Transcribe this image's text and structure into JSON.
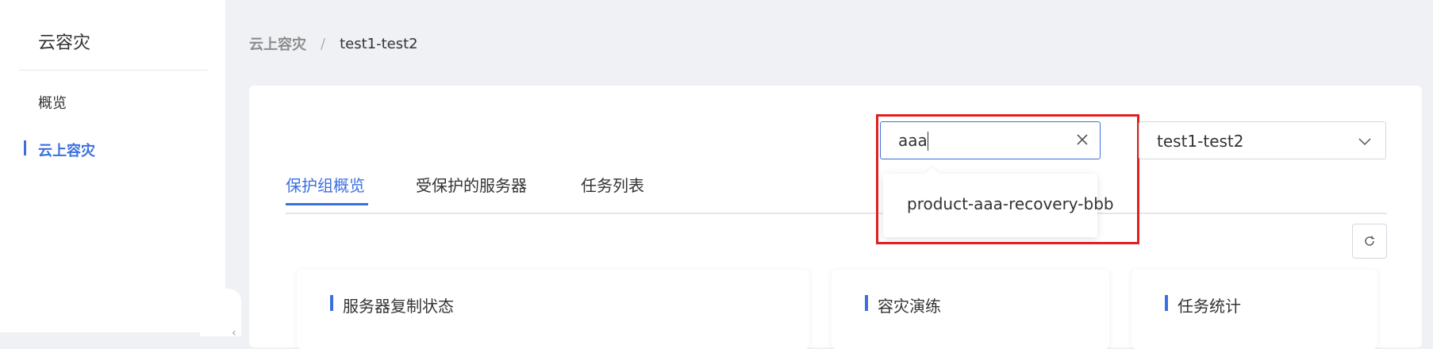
{
  "sidebar": {
    "title": "云容灾",
    "items": [
      {
        "label": "概览"
      },
      {
        "label": "云上容灾"
      }
    ]
  },
  "breadcrumb": {
    "root": "云上容灾",
    "separator": "/",
    "current": "test1-test2"
  },
  "tabs": [
    {
      "label": "保护组概览"
    },
    {
      "label": "受保护的服务器"
    },
    {
      "label": "任务列表"
    }
  ],
  "search": {
    "value": "aaa",
    "suggestions": [
      "product-aaa-recovery-bbb"
    ]
  },
  "select": {
    "value": "test1-test2"
  },
  "panels": [
    {
      "title": "服务器复制状态"
    },
    {
      "title": "容灾演练"
    },
    {
      "title": "任务统计"
    }
  ],
  "colors": {
    "accent": "#3b6fe0",
    "highlight": "#e02020",
    "background": "#f0f1f5"
  },
  "icons": {
    "clear": "close-icon",
    "select": "chevron-down-icon",
    "refresh": "refresh-icon"
  }
}
